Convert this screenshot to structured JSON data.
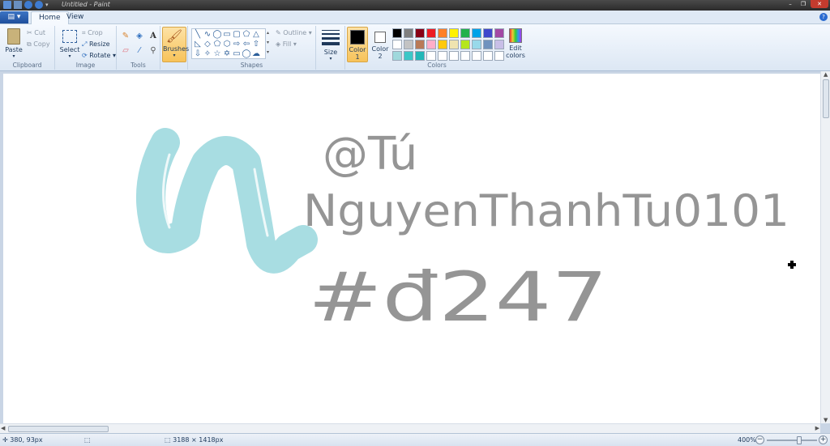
{
  "window": {
    "title": "Untitled - Paint"
  },
  "tabs": [
    {
      "label": "Home",
      "active": true
    },
    {
      "label": "View",
      "active": false
    }
  ],
  "clipboard": {
    "paste_label": "Paste",
    "cut_label": "Cut",
    "copy_label": "Copy",
    "group_label": "Clipboard"
  },
  "image": {
    "select_label": "Select",
    "crop_label": "Crop",
    "resize_label": "Resize",
    "rotate_label": "Rotate",
    "group_label": "Image"
  },
  "tools": {
    "group_label": "Tools",
    "icons": [
      "pencil-icon",
      "fill-icon",
      "text-icon",
      "eraser-icon",
      "color-picker-icon",
      "magnifier-icon"
    ]
  },
  "brushes": {
    "label": "Brushes"
  },
  "shapes": {
    "group_label": "Shapes",
    "outline_label": "Outline",
    "fill_label": "Fill"
  },
  "size": {
    "label": "Size"
  },
  "colors": {
    "color1_label": "Color",
    "color1_num": "1",
    "color2_label": "Color",
    "color2_num": "2",
    "edit_label": "Edit",
    "edit_label2": "colors",
    "group_label": "Colors",
    "color1_value": "#000000",
    "color2_value": "#ffffff",
    "palette": [
      "#000000",
      "#7f7f7f",
      "#880015",
      "#ed1c24",
      "#ff7f27",
      "#fff200",
      "#22b14c",
      "#00a2e8",
      "#3f48cc",
      "#a349a4",
      "#ffffff",
      "#c3c3c3",
      "#b97a57",
      "#ffaec9",
      "#ffc90e",
      "#efe4b0",
      "#b5e61d",
      "#99d9ea",
      "#7092be",
      "#c8bfe7",
      "#9fd8dc",
      "#3cc7c7",
      "#22b7b7",
      "#ffffff",
      "#ffffff",
      "#ffffff",
      "#ffffff",
      "#ffffff",
      "#ffffff",
      "#ffffff"
    ]
  },
  "canvas": {
    "line1": "@Tú",
    "line2": "NguyenThanhTu0101",
    "line3": "#đ247",
    "stroke_color": "#a8dde2"
  },
  "status": {
    "cursor_pos": "380, 93px",
    "image_size": "3188 × 1418px",
    "zoom": "400%"
  }
}
